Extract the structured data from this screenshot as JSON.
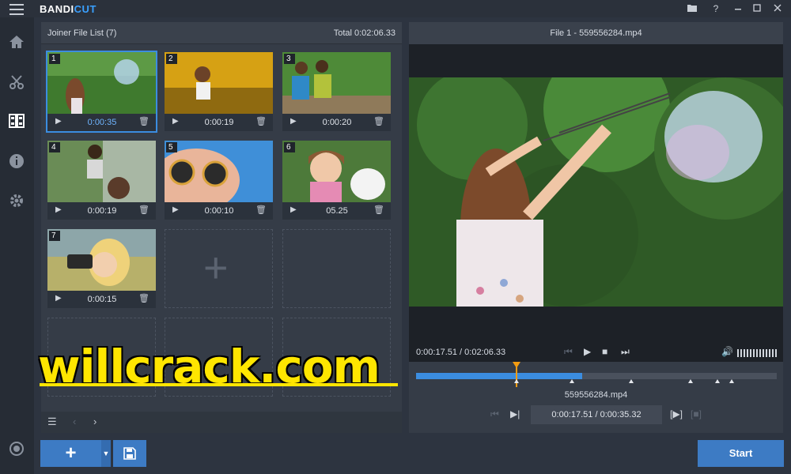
{
  "app": {
    "logo_main": "BANDI",
    "logo_accent": "CUT"
  },
  "window_controls": [
    "folder-icon",
    "help-icon",
    "minimize-icon",
    "maximize-icon",
    "close-icon"
  ],
  "window_control_glyphs": {
    "help": "?"
  },
  "rail": [
    "home-icon",
    "cut-icon",
    "joiner-icon",
    "info-icon",
    "settings-icon",
    "record-icon"
  ],
  "left_panel": {
    "title": "Joiner File List (7)",
    "total": "Total 0:02:06.33",
    "tiles": [
      {
        "num": "1",
        "duration": "0:00:35",
        "selected": true
      },
      {
        "num": "2",
        "duration": "0:00:19"
      },
      {
        "num": "3",
        "duration": "0:00:20"
      },
      {
        "num": "4",
        "duration": "0:00:19"
      },
      {
        "num": "5",
        "duration": "0:00:10"
      },
      {
        "num": "6",
        "duration": "05.25"
      },
      {
        "num": "7",
        "duration": "0:00:15"
      }
    ],
    "empty_slot_plus": "+"
  },
  "right_panel": {
    "title": "File 1 - 559556284.mp4",
    "time_current": "0:00:17.51",
    "time_total": "0:02:06.33",
    "time_sep": " / ",
    "progress_fraction": 0.277,
    "filename": "559556284.mp4",
    "segment_time": "0:00:17.51 / 0:00:35.32"
  },
  "bottom": {
    "add_label": "+",
    "start_label": "Start"
  },
  "watermark": "willcrack.com",
  "colors": {
    "accent": "#3d7bc4",
    "timeline_fill": "#3b8de0",
    "playhead": "#f39c12",
    "watermark": "#ffe600"
  }
}
